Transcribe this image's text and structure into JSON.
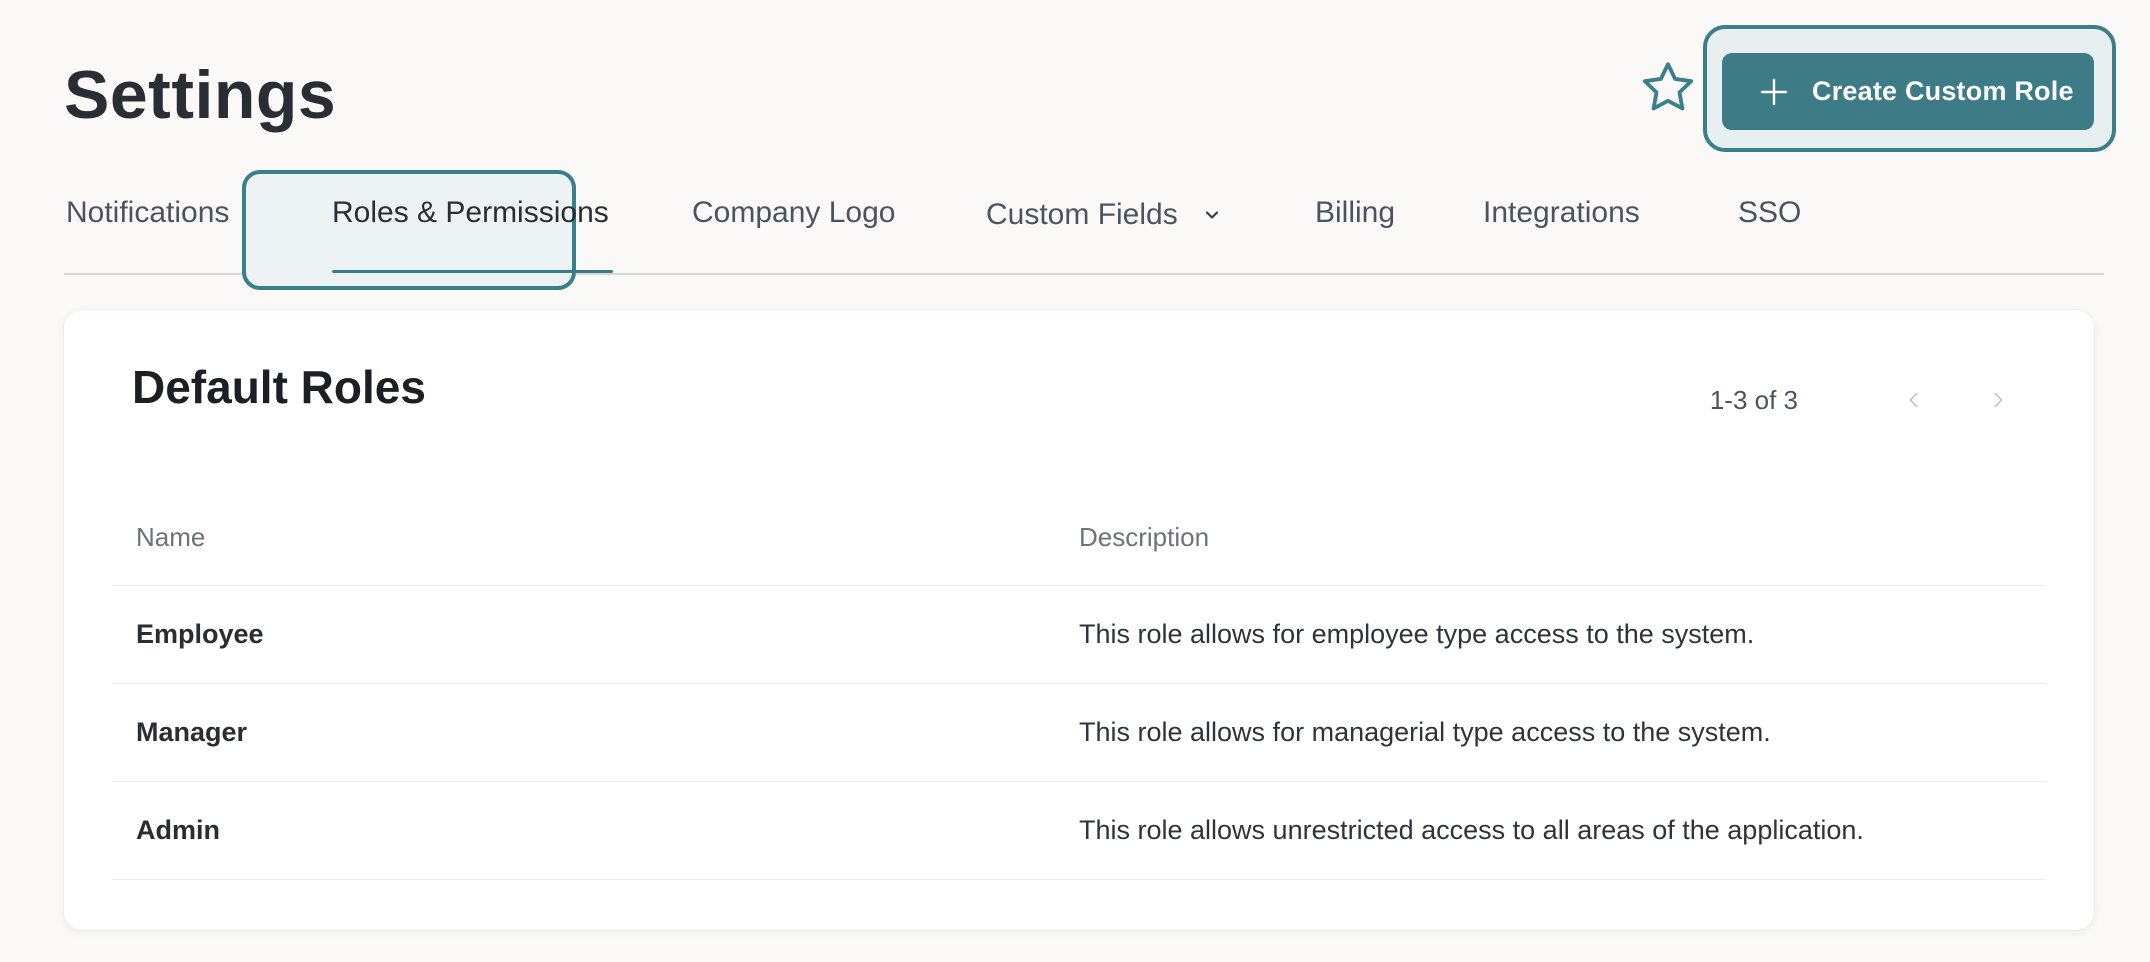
{
  "header": {
    "title": "Settings",
    "create_button_label": "Create Custom Role"
  },
  "tabs": [
    {
      "label": "Notifications",
      "active": false
    },
    {
      "label": "Roles & Permissions",
      "active": true
    },
    {
      "label": "Company Logo",
      "active": false
    },
    {
      "label": "Custom Fields",
      "active": false,
      "dropdown": true
    },
    {
      "label": "Billing",
      "active": false
    },
    {
      "label": "Integrations",
      "active": false
    },
    {
      "label": "SSO",
      "active": false
    }
  ],
  "card": {
    "title": "Default Roles",
    "pagination": {
      "count_label": "1-3 of 3"
    },
    "table": {
      "columns": [
        "Name",
        "Description"
      ],
      "rows": [
        {
          "name": "Employee",
          "description": "This role allows for employee type access to the system."
        },
        {
          "name": "Manager",
          "description": "This role allows for managerial type access to the system."
        },
        {
          "name": "Admin",
          "description": "This role allows unrestricted access to all areas of the application."
        }
      ]
    }
  },
  "icons": {
    "favorite": "star-icon",
    "create": "plus-icon",
    "dropdown": "chevron-down-icon",
    "prev": "chevron-left-icon",
    "next": "chevron-right-icon"
  },
  "colors": {
    "accent": "#3d7b86",
    "focus_ring": "#3a7f8a",
    "background": "#faf9f7"
  }
}
